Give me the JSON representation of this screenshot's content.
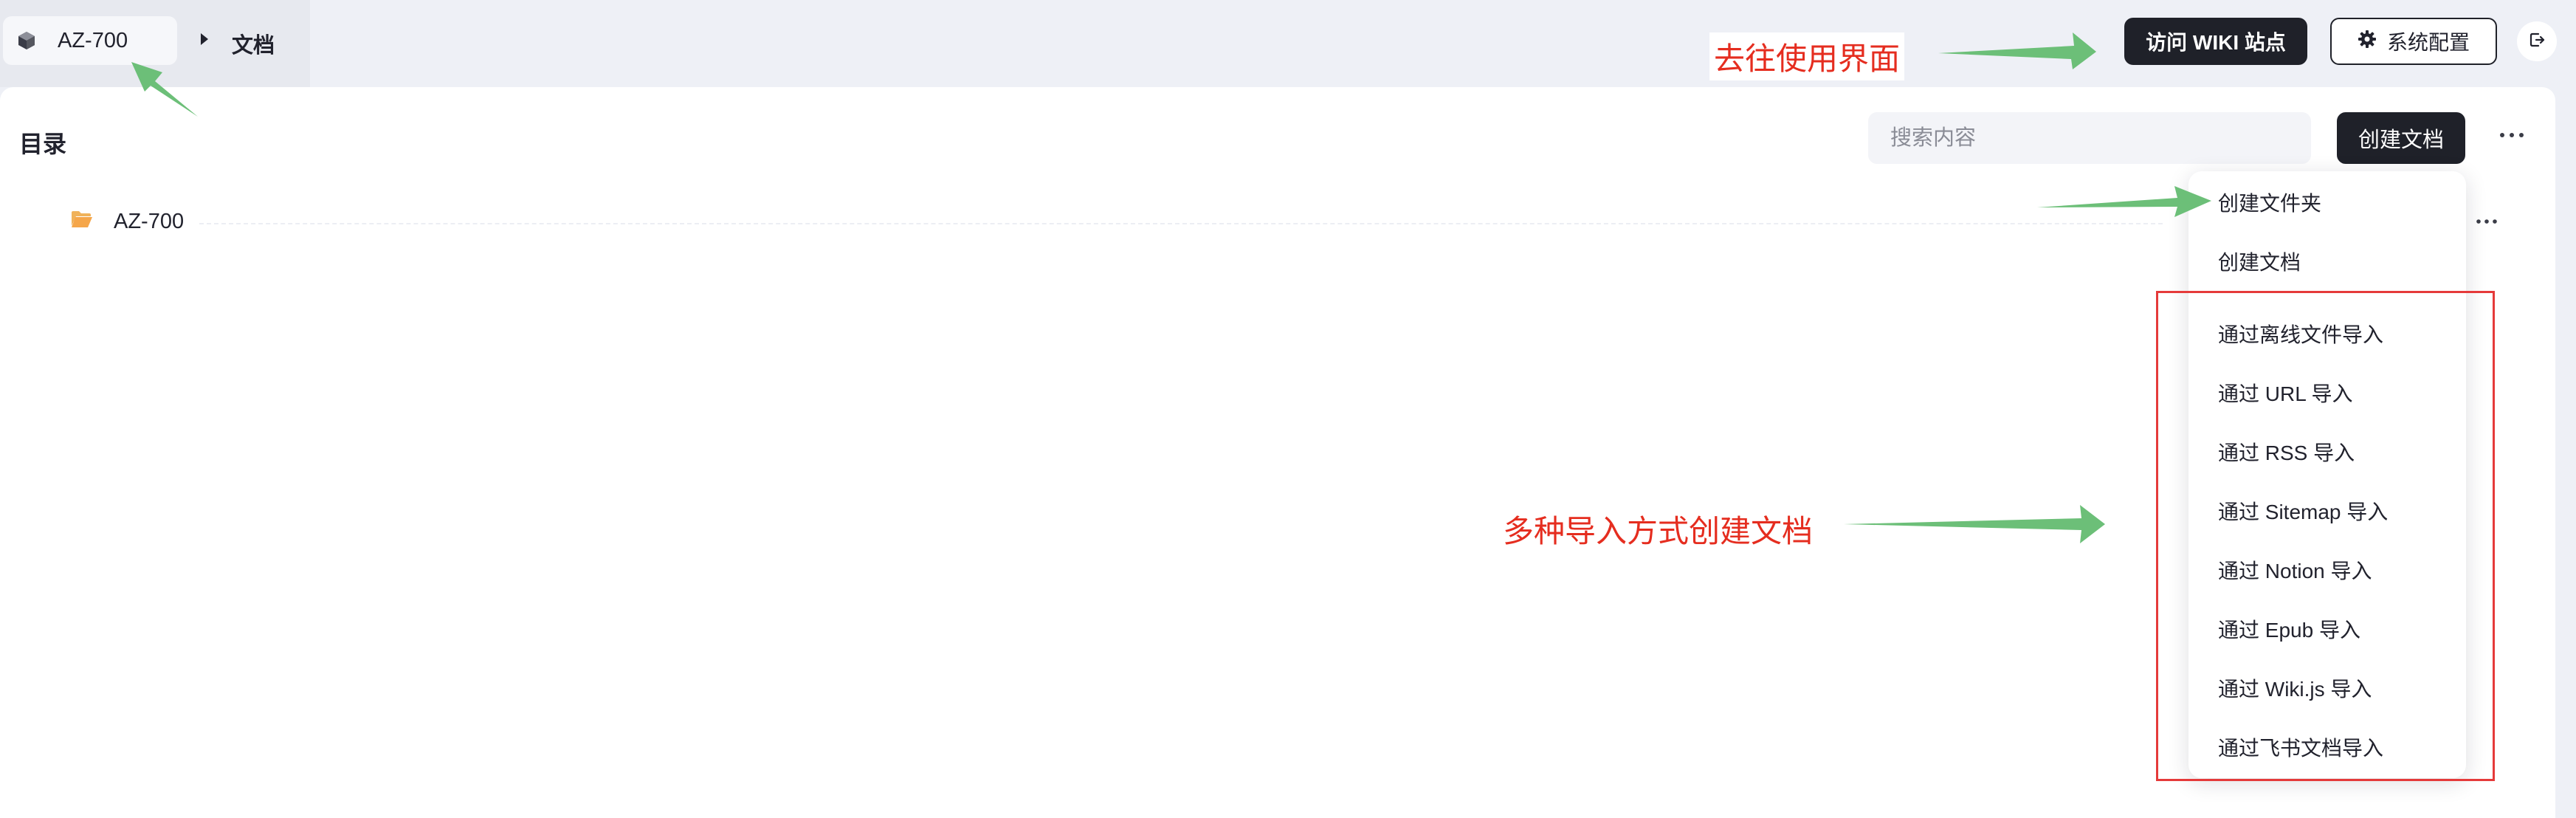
{
  "breadcrumb": {
    "kb_name": "AZ-700",
    "current": "文档"
  },
  "header": {
    "visit_wiki_label": "访问 WIKI 站点",
    "config_label": "系统配置"
  },
  "catalog": {
    "title": "目录",
    "search_placeholder": "搜索内容",
    "create_doc_label": "创建文档",
    "tree": [
      {
        "name": "AZ-700",
        "type": "folder"
      }
    ]
  },
  "dropdown": {
    "items": [
      "创建文件夹",
      "创建文档",
      "通过离线文件导入",
      "通过 URL 导入",
      "通过 RSS 导入",
      "通过 Sitemap 导入",
      "通过 Notion 导入",
      "通过 Epub 导入",
      "通过 Wiki.js 导入",
      "通过飞书文档导入"
    ]
  },
  "annotations": {
    "goto_ui": "去往使用界面",
    "multi_import": "多种导入方式创建文档"
  },
  "colors": {
    "accent_dark": "#1f2129",
    "annotation_red": "#e52d1f",
    "arrow_green": "#6cbf78",
    "folder_orange": "#f5a64a"
  }
}
